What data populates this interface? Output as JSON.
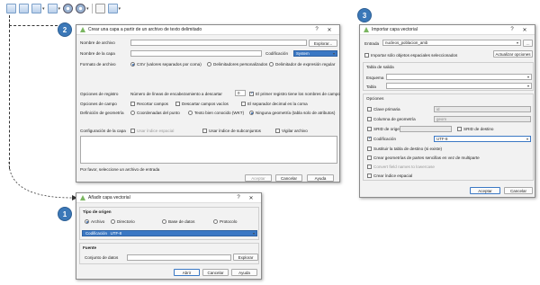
{
  "badges": [
    "1",
    "2",
    "3"
  ],
  "toolbar": {
    "icons": [
      "new-shapefile-icon",
      "new-spatialite-icon",
      "new-geopackage-icon",
      "new-memory-layer-icon",
      "add-vector-icon",
      "add-delimited-text-icon",
      "add-wms-icon",
      "help-icon",
      "layer-options-icon"
    ]
  },
  "dialog1": {
    "title": "Añadir capa vectorial",
    "help": "?",
    "close": "✕",
    "source_type_label": "Tipo de origen",
    "radios": [
      "Archivo",
      "Directorio",
      "Base de datos",
      "Protocolo"
    ],
    "encoding_label": "Codificación",
    "encoding_value": "UTF-8",
    "source_label": "Fuente",
    "datasets_label": "Conjunto de datos",
    "browse": "Explorar",
    "open": "Abrir",
    "cancel": "Cancelar",
    "help_btn": "Ayuda"
  },
  "dialog2": {
    "title": "Crear una capa a partir de un archivo de texto delimitado",
    "help": "?",
    "close": "✕",
    "file_name_label": "Nombre de archivo",
    "browse": "Explorar...",
    "layer_name_label": "Nombre de la capa",
    "encoding_label": "Codificación",
    "encoding_value": "System",
    "file_format_label": "Formato de archivo",
    "format_options": [
      "CSV (valores separados por coma)",
      "Delimitadores personalizados",
      "Delimitador de expresión regular"
    ],
    "record_options_label": "Opciones de registro",
    "header_lines_label": "Número de líneas de encabezamiento a descartar",
    "header_lines_value": "0",
    "first_record_label": "El primer registro tiene los nombres de campo",
    "field_options_label": "Opciones de campo",
    "field_options": [
      "Recortar campos",
      "Descartar campos vacíos",
      "El separador decimal es la coma"
    ],
    "geometry_label": "Definición de geometría",
    "geometry_options": [
      "Coordenadas del punto",
      "Texto bien conocido (WKT)",
      "Ninguna geometría (tabla solo de atributos)"
    ],
    "layer_config_label": "Configuración de la capa",
    "layer_config_options": [
      "Usar índice espacial",
      "Usar índice de subconjuntos",
      "Vigilar archivo"
    ],
    "status": "Por favor, seleccione un archivo de entrada",
    "accept": "Aceptar",
    "cancel": "Cancelar",
    "help_btn": "Ayuda"
  },
  "dialog3": {
    "title": "Importar capa vectorial",
    "help": "?",
    "close": "✕",
    "input_label": "Entrada",
    "input_value": "nucleos_poblacion_amb",
    "only_selected_label": "Importar sólo objetos espaciales seleccionados",
    "update_options": "Actualizar opciones",
    "output_table_label": "Tabla de salida",
    "schema_label": "Esquema",
    "table_label": "Tabla",
    "options_label": "Opciones",
    "primary_key_label": "Clave primaria",
    "primary_key_value": "id",
    "geom_column_label": "Columna de geometría",
    "geom_column_value": "geom",
    "src_srid_label": "SRID de origen",
    "dst_srid_label": "SRID de destino",
    "encoding_label": "Codificación",
    "encoding_value": "UTF-8",
    "replace_label": "Sustituir la tabla de destino (si existe)",
    "single_part_label": "Crear geometrías de partes sencillas en vez de multiparte",
    "lowercase_label": "Convert field names to lowercase",
    "spatial_index_label": "Crear índice espacial",
    "accept": "Aceptar",
    "cancel": "Cancelar"
  }
}
